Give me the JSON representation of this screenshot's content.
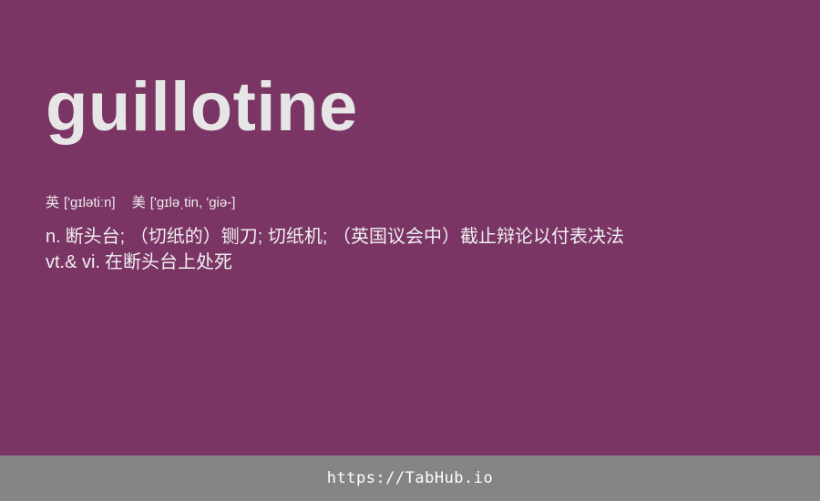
{
  "entry": {
    "word": "guillotine",
    "phonetics": [
      {
        "region": "英",
        "ipa": "['gɪlətiːn]"
      },
      {
        "region": "美",
        "ipa": "['ɡɪləˌtin, 'ɡiə-]"
      }
    ],
    "definitions": [
      {
        "pos": "n.",
        "meaning": "断头台; （切纸的）铡刀; 切纸机; （英国议会中）截止辩论以付表决法"
      },
      {
        "pos": "vt.& vi.",
        "meaning": "在断头台上处死"
      }
    ]
  },
  "footer": {
    "link_text": "https://TabHub.io"
  },
  "colors": {
    "background": "#7b3565",
    "footer_background": "#858585",
    "word_text": "#e6e6e6"
  }
}
